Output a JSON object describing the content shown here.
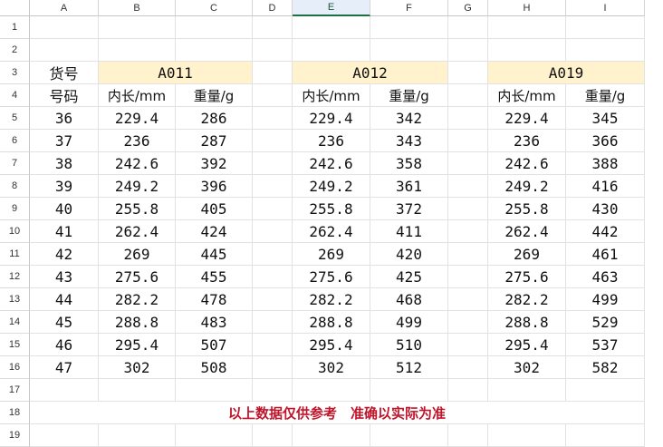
{
  "columns": [
    "A",
    "B",
    "C",
    "D",
    "E",
    "F",
    "G",
    "H",
    "I"
  ],
  "selected_column": "E",
  "row_numbers": [
    "1",
    "2",
    "3",
    "4",
    "5",
    "6",
    "7",
    "8",
    "9",
    "10",
    "11",
    "12",
    "13",
    "14",
    "15",
    "16",
    "17",
    "18",
    "19"
  ],
  "labels": {
    "item_no": "货号",
    "size_code": "号码",
    "inner_length": "内长/mm",
    "weight": "重量/g"
  },
  "models": [
    "A011",
    "A012",
    "A019"
  ],
  "sizes": [
    "36",
    "37",
    "38",
    "39",
    "40",
    "41",
    "42",
    "43",
    "44",
    "45",
    "46",
    "47"
  ],
  "inner_lengths": [
    "229.4",
    "236",
    "242.6",
    "249.2",
    "255.8",
    "262.4",
    "269",
    "275.6",
    "282.2",
    "288.8",
    "295.4",
    "302"
  ],
  "weights": {
    "A011": [
      "286",
      "287",
      "392",
      "396",
      "405",
      "424",
      "445",
      "455",
      "478",
      "483",
      "507",
      "508"
    ],
    "A012": [
      "342",
      "343",
      "358",
      "361",
      "372",
      "411",
      "420",
      "425",
      "468",
      "499",
      "510",
      "512"
    ],
    "A019": [
      "345",
      "366",
      "388",
      "416",
      "430",
      "442",
      "461",
      "463",
      "499",
      "529",
      "537",
      "582"
    ]
  },
  "note": "以上数据仅供参考　准确以实际为准",
  "colors": {
    "header_fill": "#fff2cc",
    "note_color": "#c0142a",
    "selected_col": "#1e7145"
  }
}
